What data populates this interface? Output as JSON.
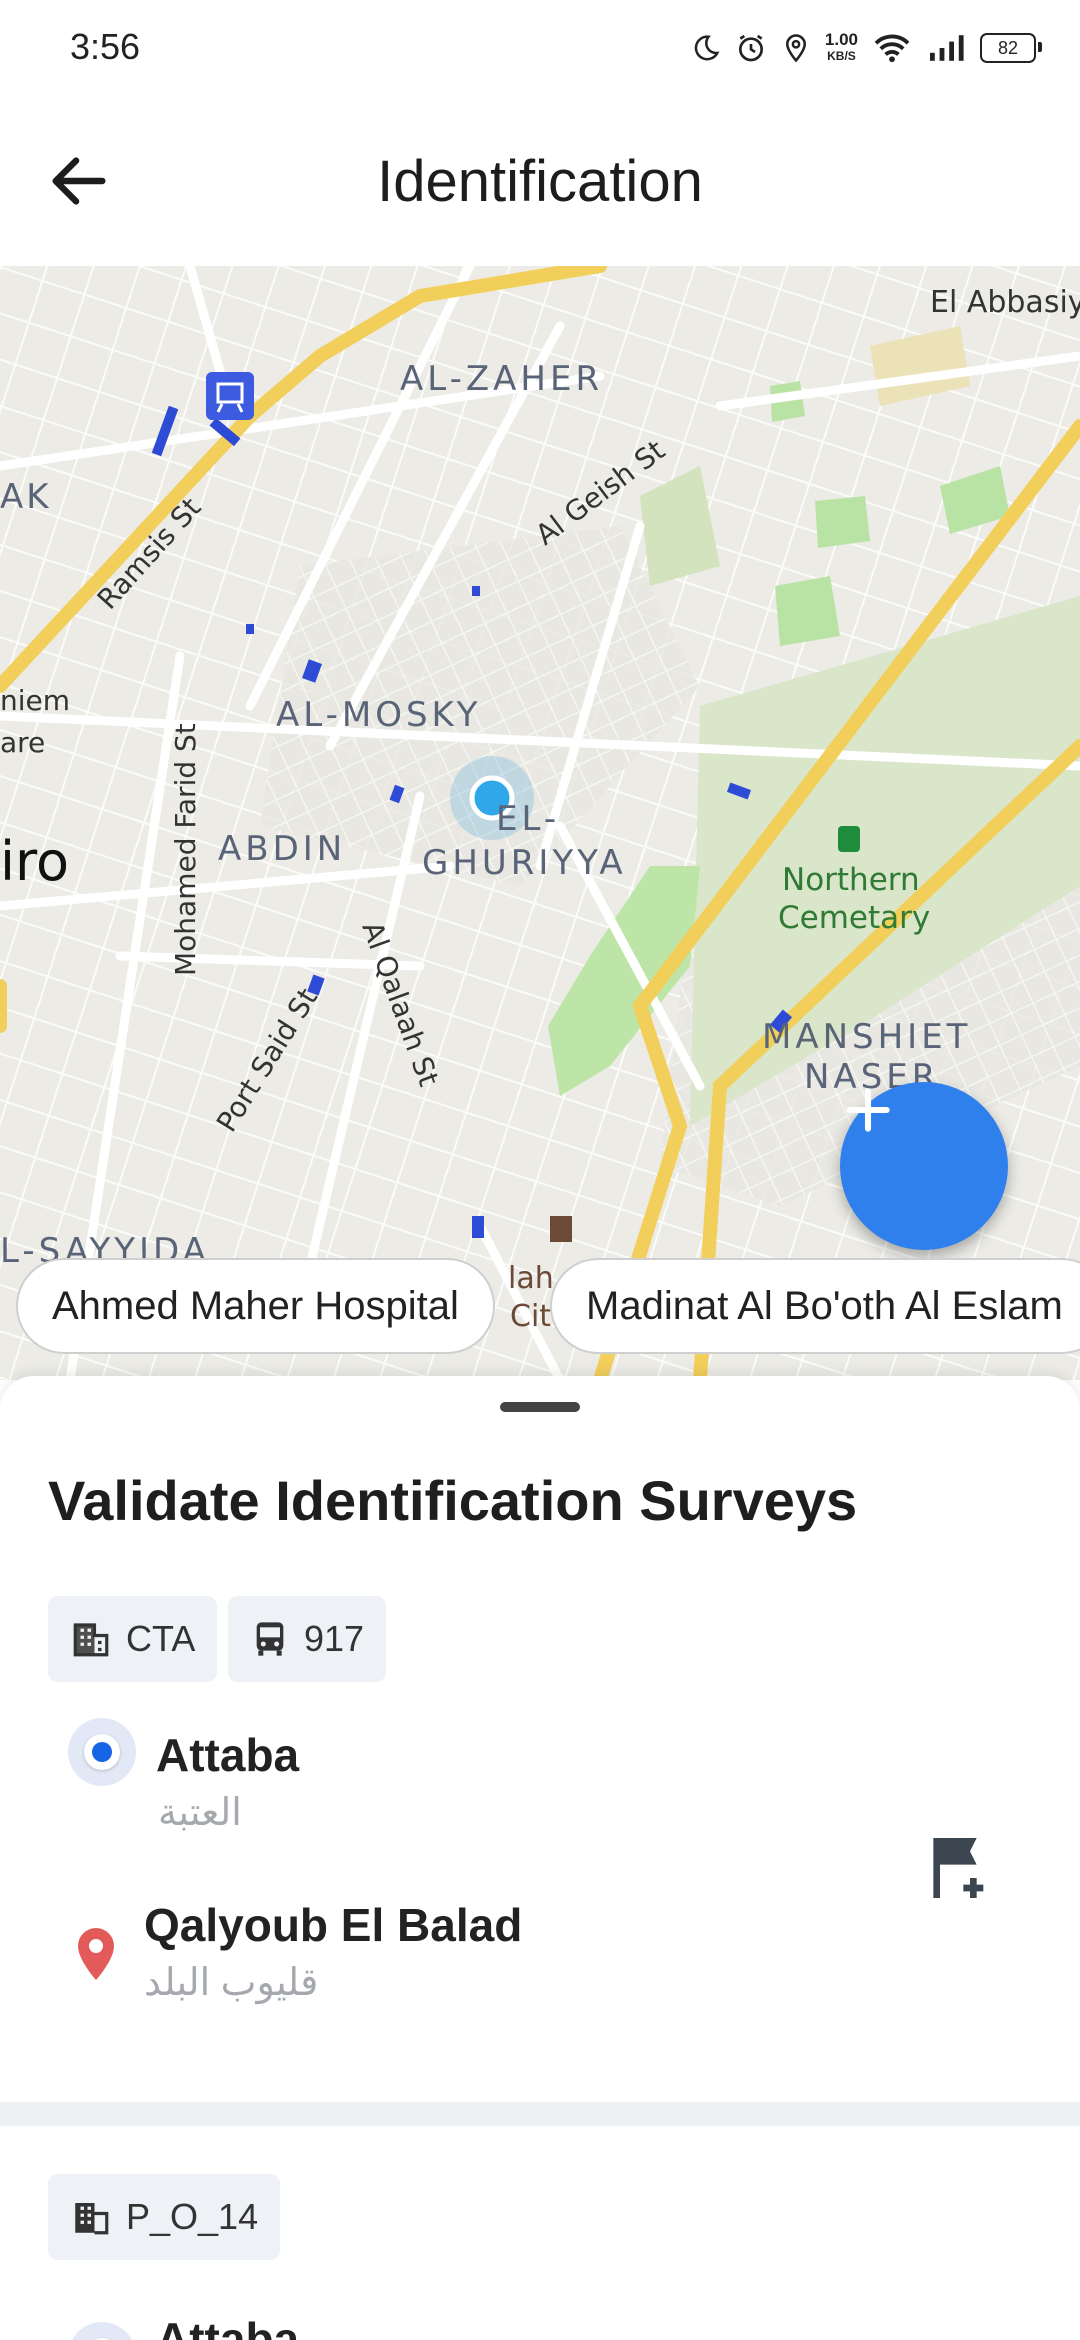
{
  "status_bar": {
    "time": "3:56",
    "net_speed_value": "1.00",
    "net_speed_unit": "KB/S",
    "battery": "82"
  },
  "app_bar": {
    "title": "Identification"
  },
  "map": {
    "labels": {
      "el_abbasiya": "El Abbasiy",
      "al_zaher": "AL-ZAHER",
      "al_geish": "Al Geish St",
      "ramsis": "Ramsis St",
      "ak": "AK",
      "niem": "niem",
      "are": "are",
      "iro": "iro",
      "al_mosky": "AL-MOSKY",
      "mohamed_farid": "Mohamed Farid St",
      "abdin": "ABDIN",
      "el": "EL-",
      "ghuriyya": "GHURIYYA",
      "northern": "Northern",
      "cemetary": "Cemetary",
      "al_qalaah": "Al Qalaah St",
      "port_said": "Port Said St",
      "manshiet": "MANSHIET",
      "naser": "NASER",
      "sayyida": "L-SAYYIDA",
      "salah": "lah",
      "city": "Cit"
    },
    "chips": [
      "Ahmed Maher Hospital",
      "Madinat Al Bo'oth Al Eslam"
    ],
    "fab_icon": "plus-icon"
  },
  "sheet": {
    "title": "Validate Identification Surveys",
    "survey1": {
      "agency": "CTA",
      "route": "917",
      "origin": {
        "name": "Attaba",
        "name_ar": "العتبة"
      },
      "destination": {
        "name": "Qalyoub El Balad",
        "name_ar": "قليوب البلد"
      }
    },
    "survey2": {
      "agency": "P_O_14",
      "origin": {
        "name": "Attaba"
      }
    }
  },
  "colors": {
    "accent": "#2f80ed",
    "radio": "#1864e6",
    "pin": "#e25a5a",
    "highway": "#f2cf5b",
    "park": "#bde5a8"
  }
}
